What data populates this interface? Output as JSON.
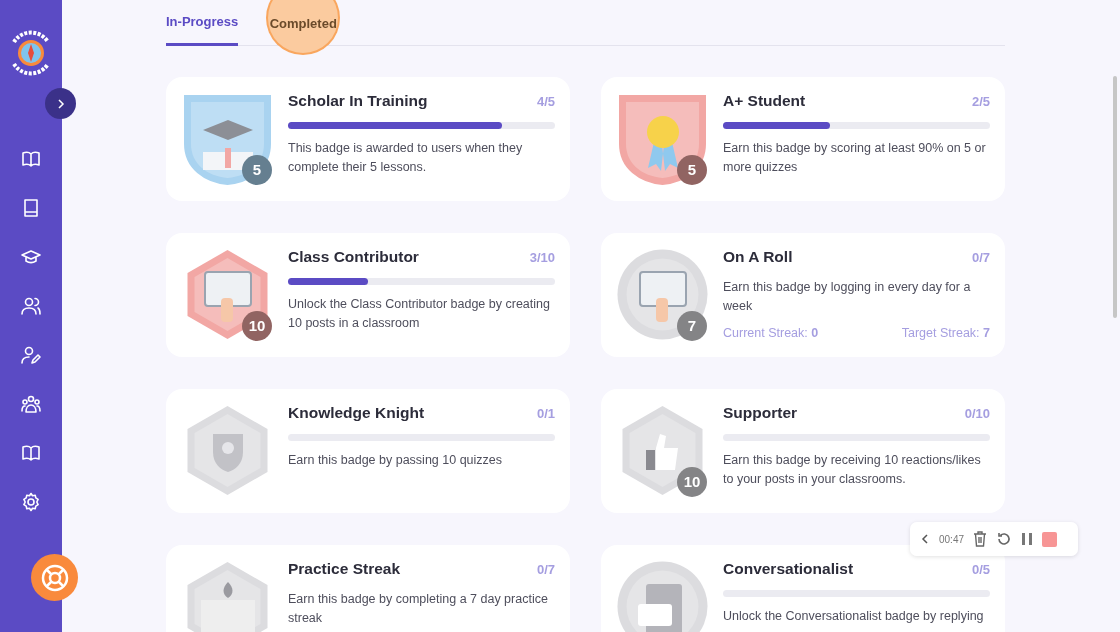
{
  "tabs": [
    {
      "label": "In-Progress",
      "selected": true
    },
    {
      "label": "Completed",
      "selected": false,
      "highlighted": true
    }
  ],
  "badges": [
    {
      "title": "Scholar In Training",
      "count": "4/5",
      "level": 0.8,
      "description": "This badge is awarded to users when they complete their 5 lessons.",
      "color": "#a9d3f0",
      "number": "5"
    },
    {
      "title": "A+ Student",
      "count": "2/5",
      "level": 0.4,
      "description": "Earn this badge by scoring at least 90% on 5 or more quizzes",
      "color": "#f2a7a4",
      "number": "5"
    },
    {
      "title": "Class Contributor",
      "count": "3/10",
      "level": 0.3,
      "description": "Unlock the Class Contributor badge by creating 10 posts in a classroom",
      "color": "#f2a7a4",
      "number": "10"
    },
    {
      "title": "On A Roll",
      "count": "0/7",
      "description": "Earn this badge by logging in every day for a week",
      "color": "#dcdcdf",
      "number": "7",
      "streak": {
        "current_label": "Current Streak:",
        "current": "0",
        "target_label": "Target Streak:",
        "target": "7"
      }
    },
    {
      "title": "Knowledge Knight",
      "count": "0/1",
      "level": 0,
      "description": "Earn this badge by passing 10 quizzes",
      "color": "#dcdcdf"
    },
    {
      "title": "Supporter",
      "count": "0/10",
      "level": 0,
      "description": "Earn this badge by receiving 10 reactions/likes to your posts in your classrooms.",
      "color": "#dcdcdf",
      "number": "10"
    },
    {
      "title": "Practice Streak",
      "count": "0/7",
      "description": "Earn this badge by completing a 7 day practice streak",
      "color": "#dcdcdf"
    },
    {
      "title": "Conversationalist",
      "count": "0/5",
      "level": 0,
      "description": "Unlock the Conversationalist badge by replying",
      "color": "#dcdcdf"
    }
  ],
  "recorder": {
    "time": "00:47"
  }
}
